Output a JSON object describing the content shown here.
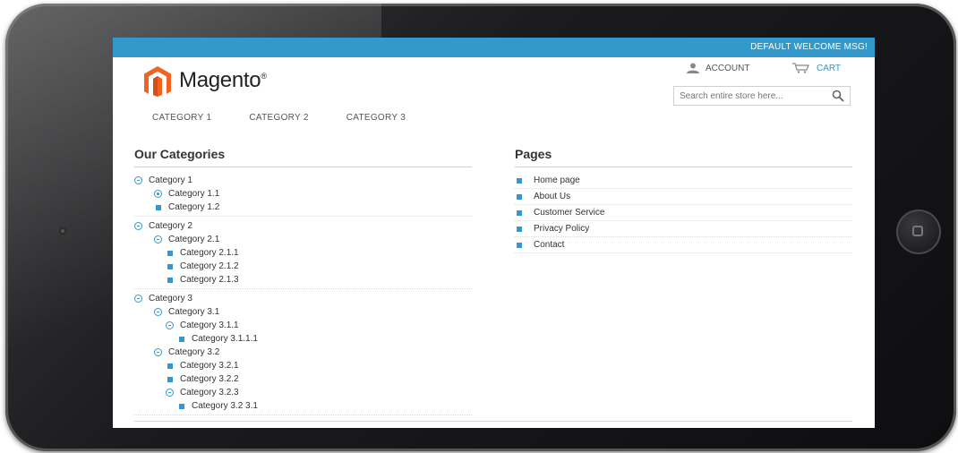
{
  "topbar": {
    "welcome": "DEFAULT WELCOME MSG!"
  },
  "header": {
    "logo_text": "Magento",
    "logo_mark": "®",
    "account_label": "ACCOUNT",
    "cart_label": "CART",
    "search_placeholder": "Search entire store here..."
  },
  "nav": {
    "items": [
      {
        "label": "CATEGORY 1"
      },
      {
        "label": "CATEGORY 2"
      },
      {
        "label": "CATEGORY 3"
      }
    ]
  },
  "categories": {
    "title": "Our Categories",
    "rows": [
      {
        "label": "Category 1"
      },
      {
        "label": "Category 1.1"
      },
      {
        "label": "Category 1.2"
      },
      {
        "label": "Category 2"
      },
      {
        "label": "Category 2.1"
      },
      {
        "label": "Category 2.1.1"
      },
      {
        "label": "Category 2.1.2"
      },
      {
        "label": "Category 2.1.3"
      },
      {
        "label": "Category 3"
      },
      {
        "label": "Category 3.1"
      },
      {
        "label": "Category 3.1.1"
      },
      {
        "label": "Category 3.1.1.1"
      },
      {
        "label": "Category 3.2"
      },
      {
        "label": "Category 3.2.1"
      },
      {
        "label": "Category 3.2.2"
      },
      {
        "label": "Category 3.2.3"
      },
      {
        "label": "Category 3.2 3.1"
      }
    ]
  },
  "pages": {
    "title": "Pages",
    "items": [
      {
        "label": "Home page"
      },
      {
        "label": "About Us"
      },
      {
        "label": "Customer Service"
      },
      {
        "label": "Privacy Policy"
      },
      {
        "label": "Contact"
      }
    ]
  },
  "colors": {
    "accent": "#3399cc",
    "logo_orange": "#f26322"
  },
  "icons": {
    "expanded": "minus-circle-icon",
    "collapsed": "dot-circle-icon",
    "leaf": "square-bullet-icon",
    "account": "user-icon",
    "cart": "cart-icon",
    "search": "magnifier-icon"
  }
}
